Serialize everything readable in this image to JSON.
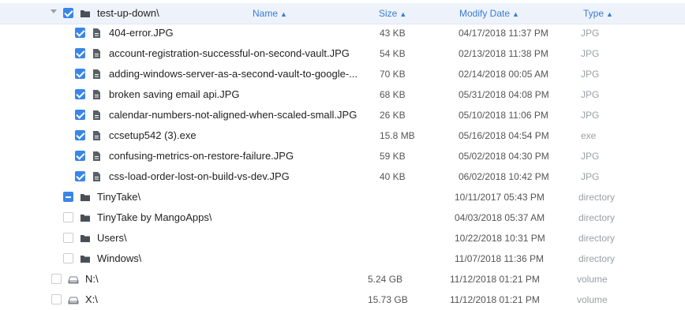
{
  "header": {
    "folder_name": "test-up-down\\",
    "col_name": "Name",
    "col_size": "Size",
    "col_date": "Modify Date",
    "col_type": "Type",
    "sort_icon": "sort-icon"
  },
  "files": [
    {
      "name": "404-error.JPG",
      "size": "43 KB",
      "date": "04/17/2018 11:37 PM",
      "type": "JPG"
    },
    {
      "name": "account-registration-successful-on-second-vault.JPG",
      "size": "54 KB",
      "date": "02/13/2018 11:38 PM",
      "type": "JPG"
    },
    {
      "name": "adding-windows-server-as-a-second-vault-to-google-...",
      "size": "70 KB",
      "date": "02/14/2018 00:05 AM",
      "type": "JPG"
    },
    {
      "name": "broken saving email api.JPG",
      "size": "68 KB",
      "date": "05/31/2018 04:08 PM",
      "type": "JPG"
    },
    {
      "name": "calendar-numbers-not-aligned-when-scaled-small.JPG",
      "size": "26 KB",
      "date": "05/10/2018 11:06 PM",
      "type": "JPG"
    },
    {
      "name": "ccsetup542 (3).exe",
      "size": "15.8 MB",
      "date": "05/16/2018 04:54 PM",
      "type": "exe"
    },
    {
      "name": "confusing-metrics-on-restore-failure.JPG",
      "size": "59 KB",
      "date": "05/02/2018 04:30 PM",
      "type": "JPG"
    },
    {
      "name": "css-load-order-lost-on-build-vs-dev.JPG",
      "size": "40 KB",
      "date": "06/02/2018 10:42 PM",
      "type": "JPG"
    }
  ],
  "folders": [
    {
      "name": "TinyTake\\",
      "date": "10/11/2017 05:43 PM",
      "type": "directory",
      "state": "partial"
    },
    {
      "name": "TinyTake by MangoApps\\",
      "date": "04/03/2018 05:37 AM",
      "type": "directory",
      "state": "unchecked"
    },
    {
      "name": "Users\\",
      "date": "10/22/2018 10:31 PM",
      "type": "directory",
      "state": "unchecked"
    },
    {
      "name": "Windows\\",
      "date": "11/07/2018 11:36 PM",
      "type": "directory",
      "state": "unchecked"
    }
  ],
  "drives": [
    {
      "name": "N:\\",
      "size": "5.24 GB",
      "date": "11/12/2018 01:21 PM",
      "type": "volume"
    },
    {
      "name": "X:\\",
      "size": "15.73 GB",
      "date": "11/12/2018 01:21 PM",
      "type": "volume"
    }
  ],
  "colors": {
    "accent": "#3a86e8",
    "header_bg": "#eef3fb",
    "muted": "#9aa0a6"
  },
  "icons": {
    "file": "file-icon",
    "folder": "folder-icon",
    "drive": "drive-icon",
    "expand": "caret-down-icon"
  }
}
